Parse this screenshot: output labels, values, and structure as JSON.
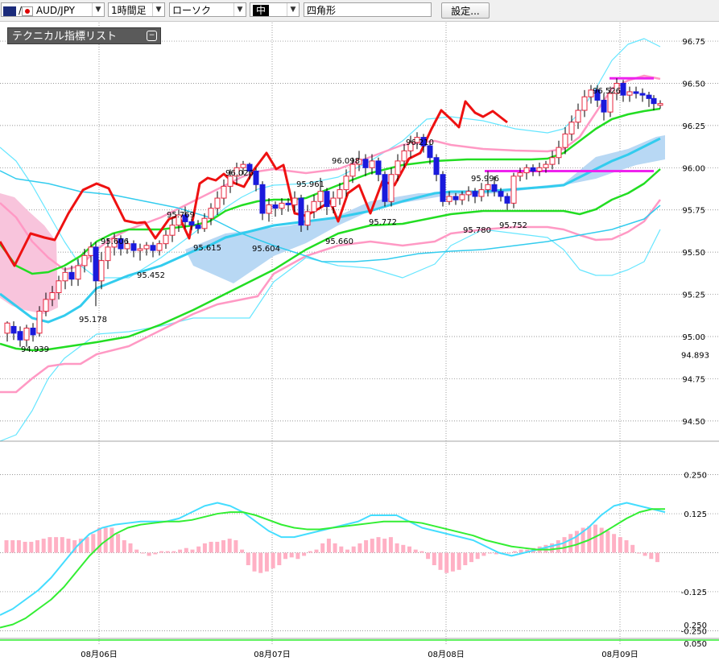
{
  "toolbar": {
    "pair": "AUD/JPY",
    "timeframe": "1時間足",
    "chart_style": "ローソク",
    "shape_size": "中",
    "shape_type": "四角形",
    "settings_label": "設定..."
  },
  "indicator_panel": {
    "title": "テクニカル指標リスト",
    "toggle_icon": "minus-icon"
  },
  "colors": {
    "bull_candle": "#e8243c",
    "bear_candle": "#1a1adc",
    "ma_short": "#33ccee",
    "ma_mid": "#22dd22",
    "bb_outer": "#66e6ff",
    "bb_inner": "#ff99c4",
    "chikou": "#ee1111",
    "cloud_bull": "#b8d8f4",
    "cloud_bear": "#f8c4dc",
    "level_line": "#ee22ee",
    "macd_line": "#44ddff",
    "signal_line": "#33ee33",
    "histogram": "#ffb0c4"
  },
  "chart_data": [
    {
      "type": "candlestick",
      "title": "",
      "y_ticks": [
        "96.75",
        "96.50",
        "96.25",
        "96.00",
        "95.75",
        "95.50",
        "95.25",
        "95.00",
        "94.75",
        "94.50"
      ],
      "current_price_label": "94.893",
      "ylim": [
        94.38,
        96.86
      ],
      "x_dates": [
        "08月06日",
        "08月07日",
        "08月08日",
        "08月09日"
      ],
      "annotations": [
        "94.939",
        "95.178",
        "95.606",
        "95.452",
        "95.769",
        "95.615",
        "96.026",
        "95.604",
        "95.961",
        "95.660",
        "96.098",
        "95.772",
        "96.210",
        "95.996",
        "95.780",
        "95.752",
        "96.526"
      ],
      "level_lines": [
        96.53,
        95.98
      ]
    },
    {
      "type": "line",
      "title": "",
      "y_ticks": [
        "0.250",
        "0.125",
        "-0.125",
        "-0.250"
      ],
      "ylim": [
        -0.28,
        0.28
      ],
      "series": [
        {
          "values": [
            -0.2,
            -0.18,
            -0.15,
            -0.12,
            -0.08,
            -0.03,
            0.02,
            0.06,
            0.08,
            0.09,
            0.095,
            0.1,
            0.1,
            0.1,
            0.11,
            0.13,
            0.15,
            0.16,
            0.15,
            0.13,
            0.1,
            0.07,
            0.05,
            0.05,
            0.06,
            0.07,
            0.08,
            0.09,
            0.1,
            0.12,
            0.12,
            0.12,
            0.1,
            0.08,
            0.07,
            0.06,
            0.05,
            0.04,
            0.02,
            0,
            -0.01,
            0,
            0.01,
            0.02,
            0.03,
            0.05,
            0.08,
            0.12,
            0.15,
            0.16,
            0.15,
            0.14,
            0.13
          ]
        },
        {
          "values": [
            -0.24,
            -0.23,
            -0.21,
            -0.18,
            -0.15,
            -0.11,
            -0.06,
            -0.01,
            0.03,
            0.06,
            0.08,
            0.09,
            0.095,
            0.1,
            0.1,
            0.105,
            0.115,
            0.125,
            0.13,
            0.13,
            0.12,
            0.105,
            0.09,
            0.08,
            0.075,
            0.075,
            0.08,
            0.085,
            0.09,
            0.095,
            0.1,
            0.1,
            0.1,
            0.095,
            0.085,
            0.075,
            0.065,
            0.055,
            0.04,
            0.03,
            0.02,
            0.015,
            0.01,
            0.01,
            0.015,
            0.025,
            0.04,
            0.06,
            0.085,
            0.11,
            0.13,
            0.14,
            0.14
          ]
        }
      ]
    }
  ]
}
